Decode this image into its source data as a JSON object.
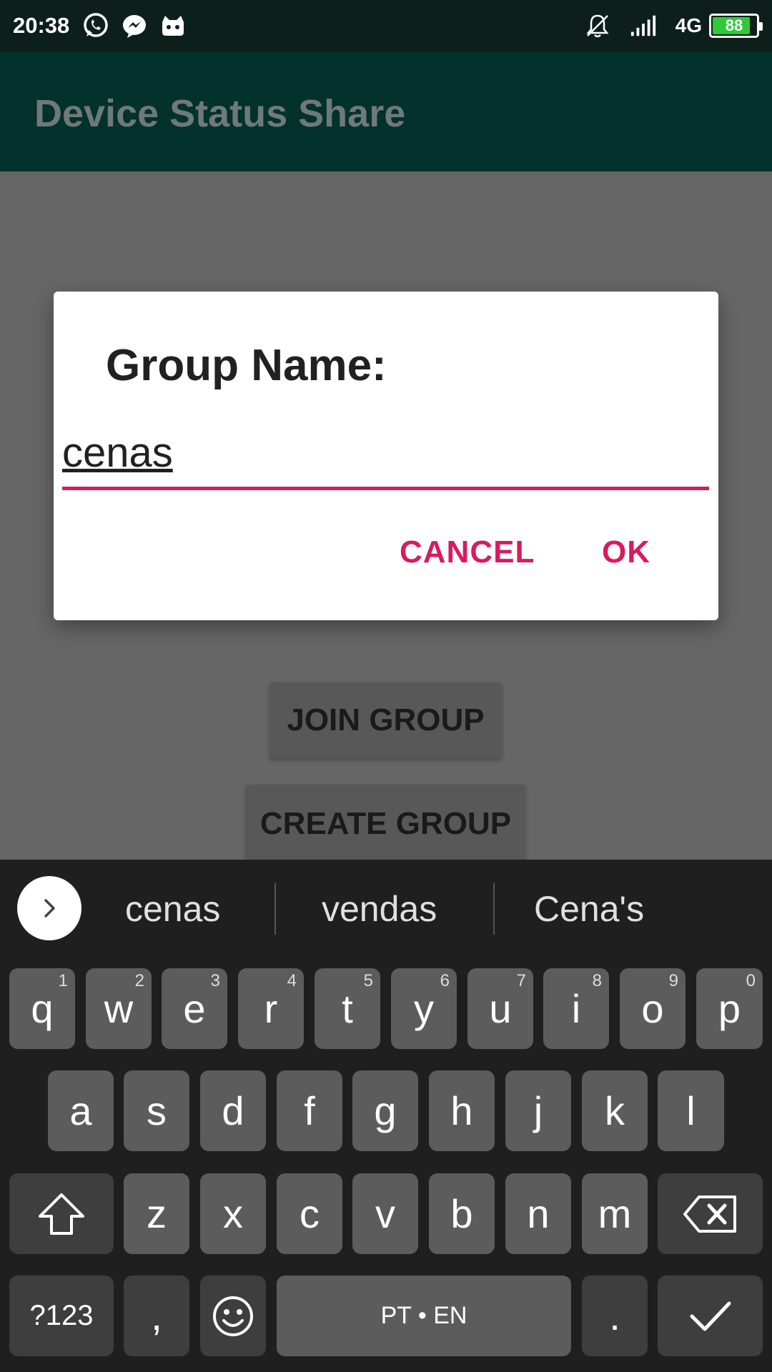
{
  "status_bar": {
    "time": "20:38",
    "network": "4G",
    "battery": "88",
    "battery_level": 0.88,
    "icons": [
      "whatsapp-icon",
      "messenger-icon",
      "cat-icon",
      "bell-off-icon",
      "signal-icon"
    ]
  },
  "app_bar": {
    "title": "Device Status Share"
  },
  "background_buttons": {
    "join": "JOIN GROUP",
    "create": "CREATE GROUP"
  },
  "dialog": {
    "title": "Group Name:",
    "input_value": "cenas",
    "cancel": "CANCEL",
    "ok": "OK",
    "accent_color": "#d81b60"
  },
  "keyboard": {
    "suggestions": [
      "cenas",
      "vendas",
      "Cena's"
    ],
    "row1": [
      {
        "key": "q",
        "hint": "1"
      },
      {
        "key": "w",
        "hint": "2"
      },
      {
        "key": "e",
        "hint": "3"
      },
      {
        "key": "r",
        "hint": "4"
      },
      {
        "key": "t",
        "hint": "5"
      },
      {
        "key": "y",
        "hint": "6"
      },
      {
        "key": "u",
        "hint": "7"
      },
      {
        "key": "i",
        "hint": "8"
      },
      {
        "key": "o",
        "hint": "9"
      },
      {
        "key": "p",
        "hint": "0"
      }
    ],
    "row2": [
      "a",
      "s",
      "d",
      "f",
      "g",
      "h",
      "j",
      "k",
      "l"
    ],
    "row3": [
      "z",
      "x",
      "c",
      "v",
      "b",
      "n",
      "m"
    ],
    "symbols": "?123",
    "comma": ",",
    "space": "PT • EN",
    "period": "."
  }
}
